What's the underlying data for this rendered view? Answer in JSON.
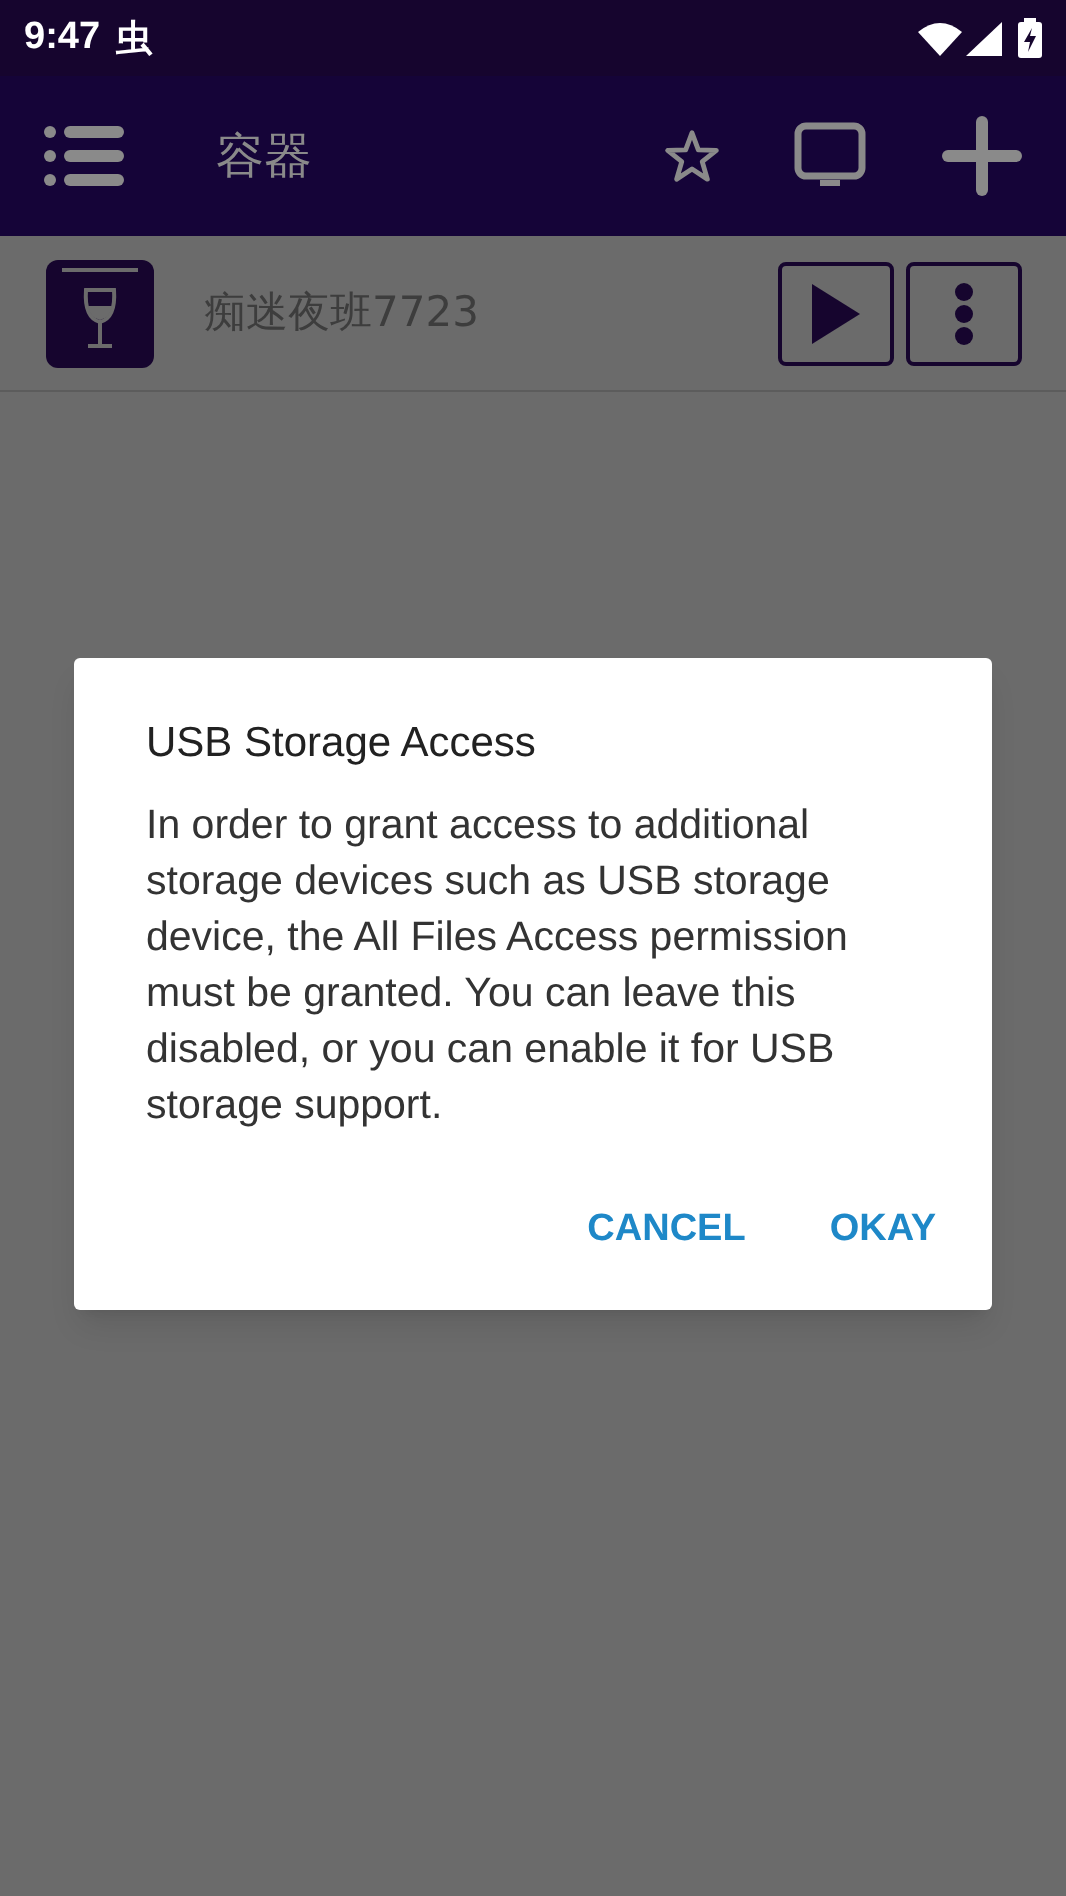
{
  "status_bar": {
    "time": "9:47",
    "notification_glyph": "虫"
  },
  "app_bar": {
    "title": "容器"
  },
  "containers": [
    {
      "name": "痴迷夜班7723"
    }
  ],
  "dialog": {
    "title": "USB Storage Access",
    "message": "In order to grant access to additional storage devices such as USB storage device, the All Files Access permission must be granted. You can leave this disabled, or you can enable it for USB storage support.",
    "buttons": [
      "CANCEL",
      "OKAY"
    ]
  }
}
